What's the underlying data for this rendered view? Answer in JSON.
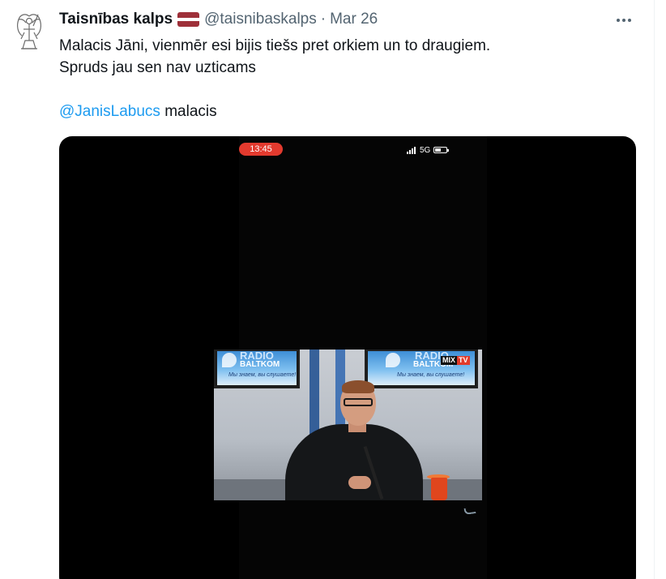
{
  "tweet": {
    "display_name": "Taisnības kalps",
    "handle": "@taisnibaskalps",
    "separator": "·",
    "date": "Mar 26",
    "flag": {
      "icon": "latvia-flag-icon",
      "colors": [
        "#9e3039",
        "#ffffff",
        "#9e3039"
      ]
    },
    "avatar": {
      "icon": "archangel-emblem-icon"
    },
    "more_icon": "more-options-icon",
    "text_line_1": "Malacis Jāni, vienmēr esi bijis tiešs pret orkiem un to draugiem.",
    "text_line_2": "Spruds jau sen nav uzticams",
    "mention": "@JanisLabucs",
    "mention_suffix": " malacis",
    "mention_color": "#1d9bf0"
  },
  "video": {
    "status_time": "13:45",
    "network": "5G",
    "tv_brand_top": "RADIO",
    "tv_brand": "BALTKOM",
    "tv_slogan": "Мы знаем, вы слушаете!",
    "channel_mix": "MIX",
    "channel_tv": "TV"
  }
}
